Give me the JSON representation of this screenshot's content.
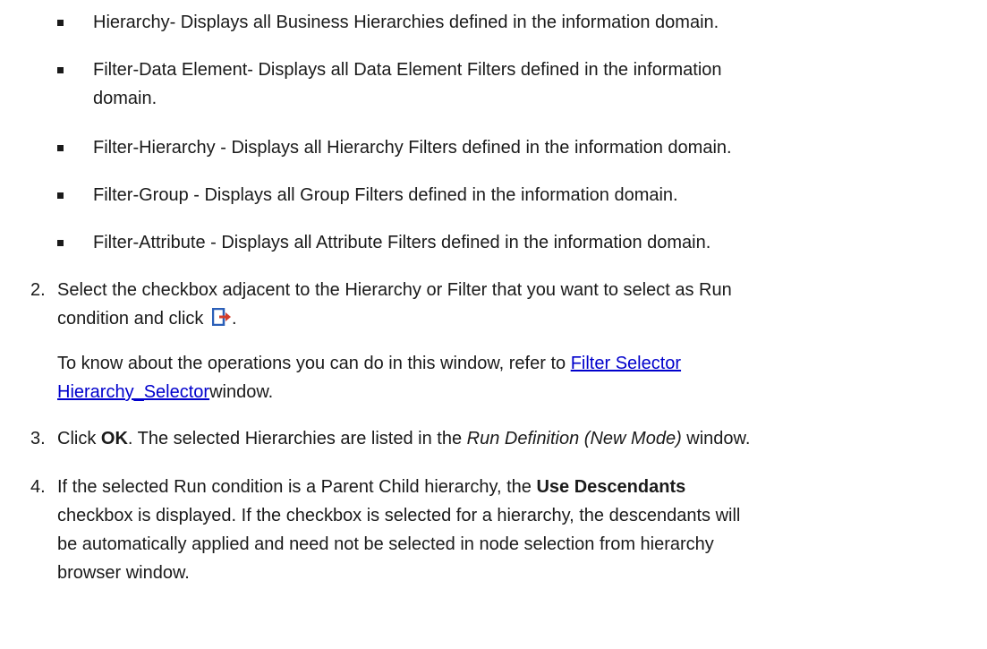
{
  "bullets": [
    "Hierarchy- Displays all Business Hierarchies defined in the information domain.",
    "Filter-Data Element- Displays all Data Element Filters defined in the information",
    "domain.",
    "Filter-Hierarchy - Displays all Hierarchy Filters defined in the information domain.",
    "Filter-Group - Displays all Group Filters defined in the information domain.",
    "Filter-Attribute - Displays all Attribute Filters defined in the information domain."
  ],
  "steps": {
    "s2": {
      "num": "2.",
      "line1": "Select the checkbox adjacent to the Hierarchy or Filter that you want to select as Run",
      "line2_text": "condition and click",
      "line2_icon": "export-arrow-icon",
      "line2_end": ".",
      "para_line1_text": "To know about the operations you can do in this window, refer to",
      "para_link1": "Filter Selector",
      "para_link2": "Hierarchy_Selector",
      "para_line2_end": "window."
    },
    "s3": {
      "num": "3.",
      "t1": "Click",
      "bold": "OK",
      "t2": ". The selected Hierarchies are listed in the",
      "ital": "Run Definition (New Mode)",
      "t3": "window."
    },
    "s4": {
      "num": "4.",
      "l1_a": "If the selected Run condition is a Parent Child hierarchy, the",
      "l1_bold": "Use Descendants",
      "l2": "checkbox is displayed. If the checkbox is selected for a hierarchy, the descendants will",
      "l3": "be automatically applied and need not be selected in node selection from hierarchy",
      "l4": "browser window."
    }
  },
  "colors": {
    "text": "#1a1a1a",
    "link": "#0000cc",
    "icon_blue": "#2b5fb8",
    "icon_red": "#d23c2a"
  }
}
